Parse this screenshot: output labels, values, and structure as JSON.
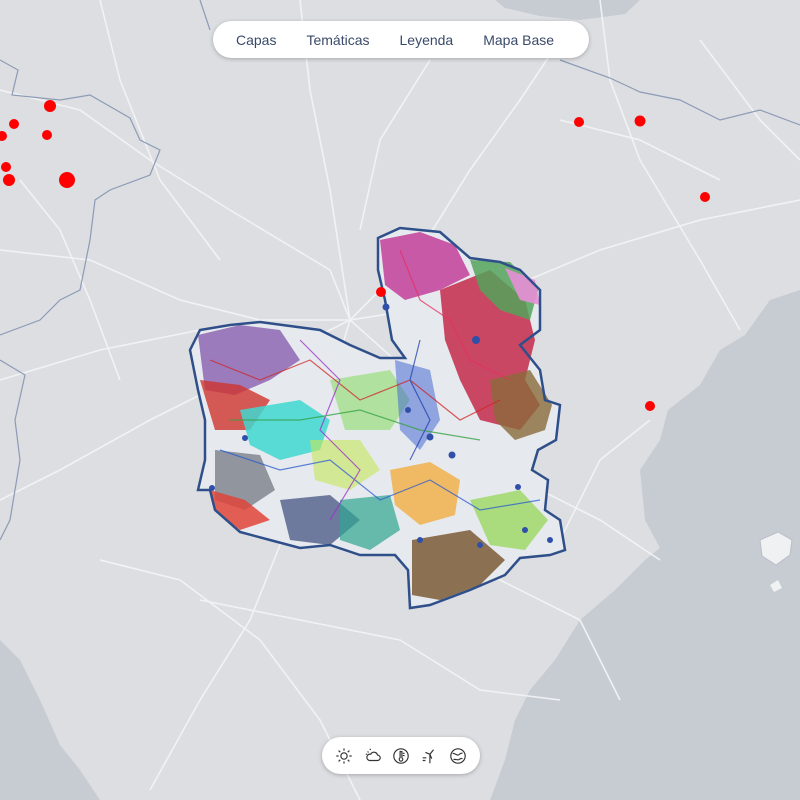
{
  "menu": {
    "items": [
      {
        "label": "Capas",
        "icon": null
      },
      {
        "label": "Temáticas",
        "icon": null
      },
      {
        "label": "Leyenda",
        "icon": null
      },
      {
        "label": "Mapa Base",
        "icon": null
      }
    ]
  },
  "toolbar": {
    "tools": [
      {
        "icon": "sun-icon"
      },
      {
        "icon": "cloud-sun-icon"
      },
      {
        "icon": "thermometer-icon"
      },
      {
        "icon": "wind-turbine-icon"
      },
      {
        "icon": "globe-icon"
      }
    ]
  },
  "map": {
    "land_color": "#dcdee2",
    "sea_color": "#c7ccd3",
    "road_color": "#f3f4f6",
    "border_color": "#8d9bb5",
    "region_outline_color": "#2f4f8a",
    "marker_color": "#ff0000"
  }
}
